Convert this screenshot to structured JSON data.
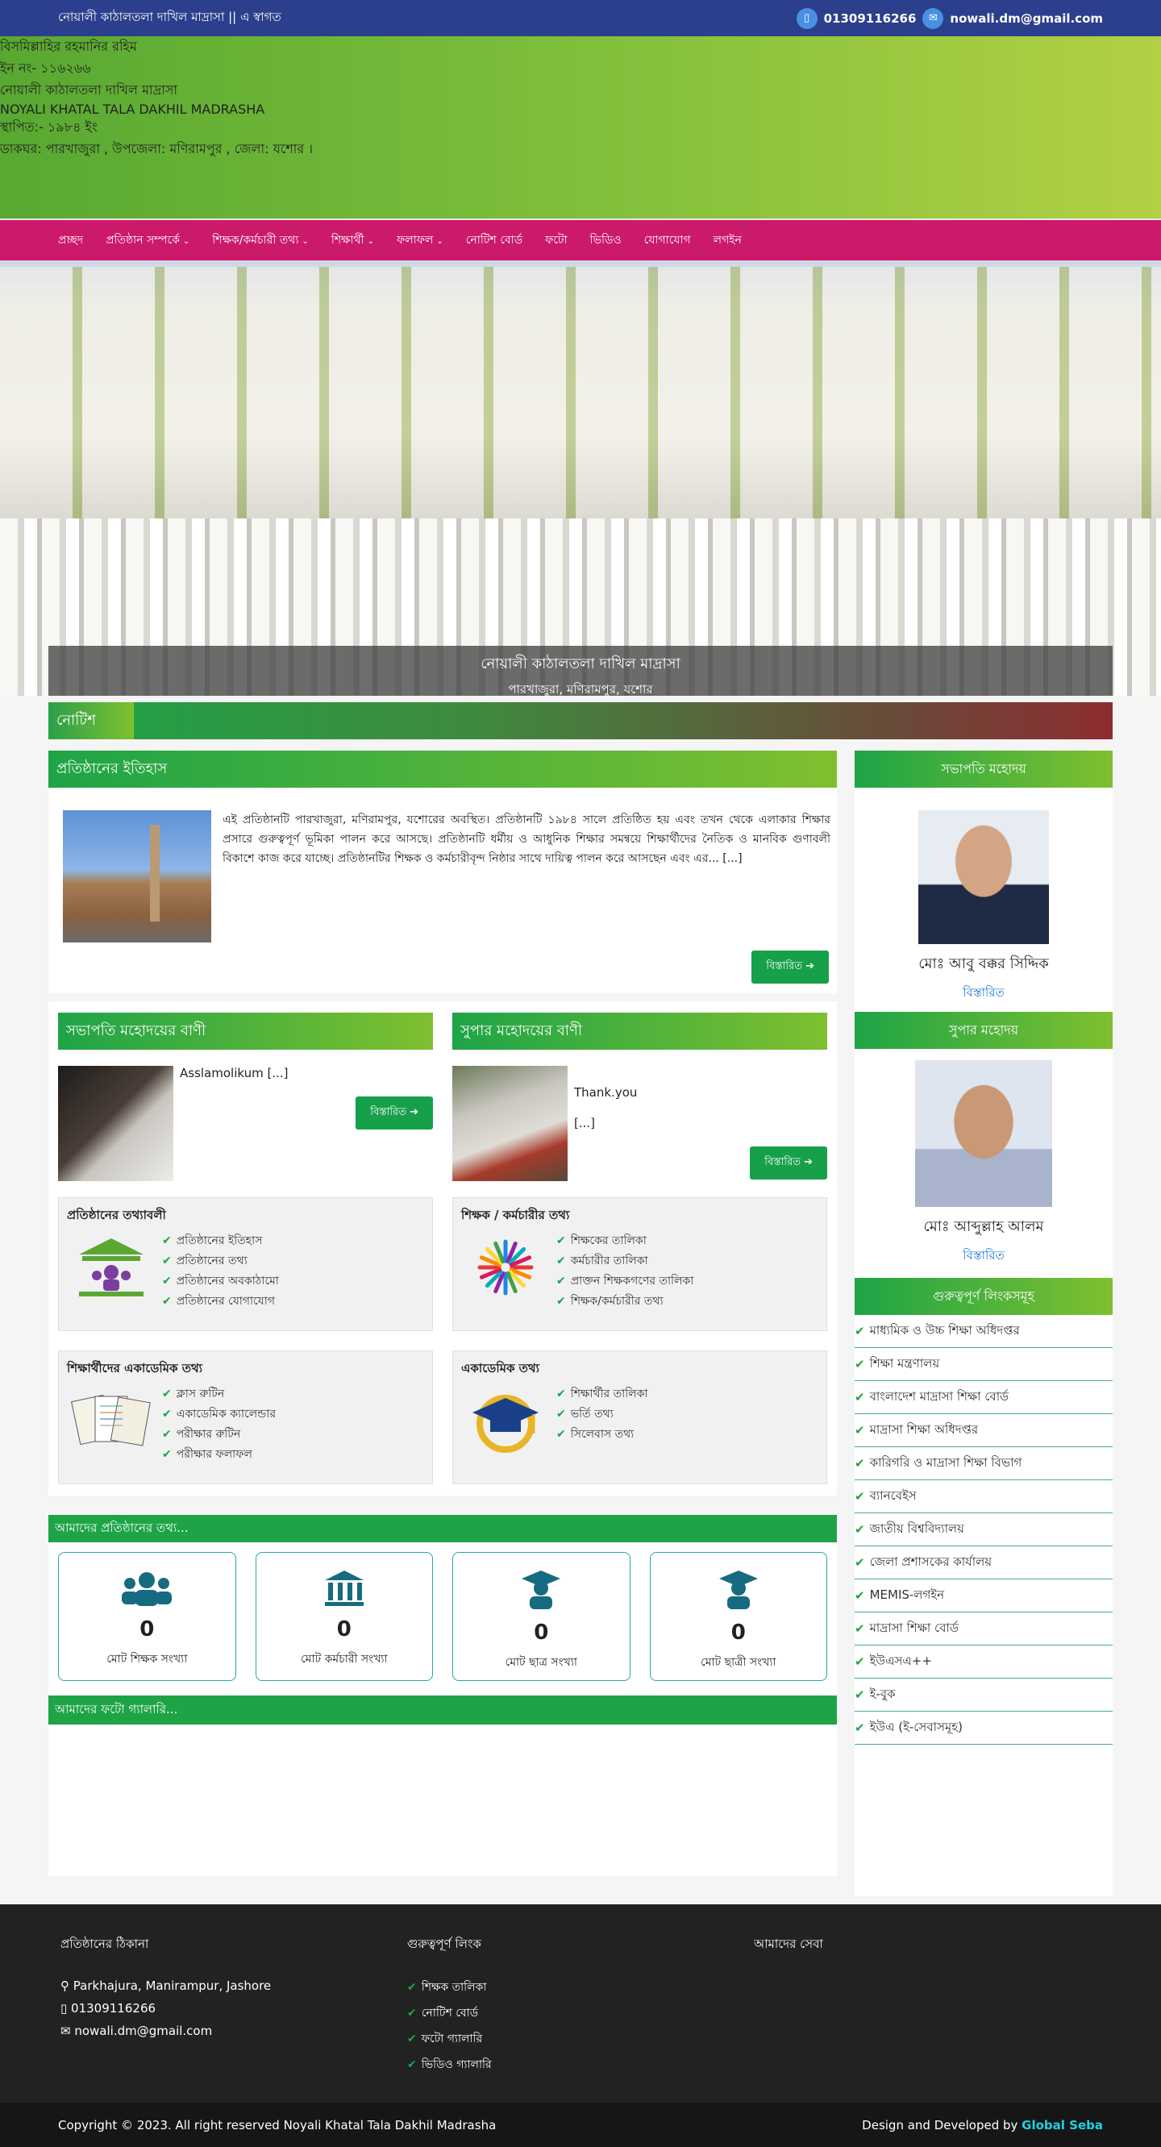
{
  "topbar": {
    "welcome": "নোয়ালী কাঠালতলা দাখিল মাদ্রাসা || এ স্বাগত",
    "phone": "01309116266",
    "email": "nowali.dm@gmail.com"
  },
  "header": {
    "bismillah": "বিসমিল্লাহির রহমানির রহিম",
    "ein": "ইন নং- ১১৬২৬৬",
    "name_bn": "নোয়ালী কাঠালতলা দাখিল মাদ্রাসা",
    "name_en": "NOYALI KHATAL TALA DAKHIL MADRASHA",
    "established": "স্থাপিত:- ১৯৮৪ ইং",
    "address": "ডাকঘর: পারখাজুরা , উপজেলা: মণিরামপুর , জেলা: যশোর ।"
  },
  "nav": {
    "items": [
      {
        "label": "প্রচ্ছদ",
        "caret": false
      },
      {
        "label": "প্রতিষ্ঠান সম্পর্কে",
        "caret": true
      },
      {
        "label": "শিক্ষক/কর্মচারী তথ্য",
        "caret": true
      },
      {
        "label": "শিক্ষার্থী",
        "caret": true
      },
      {
        "label": "ফলাফল",
        "caret": true
      },
      {
        "label": "নোটিশ বোর্ড",
        "caret": false
      },
      {
        "label": "ফটো",
        "caret": false
      },
      {
        "label": "ভিডিও",
        "caret": false
      },
      {
        "label": "যোগাযোগ",
        "caret": false
      },
      {
        "label": "লগইন",
        "caret": false
      }
    ]
  },
  "hero": {
    "title": "নোয়ালী কাঠালতলা দাখিল মাদ্রাসা",
    "subtitle": "পারখাজুরা, মণিরামপুর, যশোর"
  },
  "notice": {
    "label": "নোটিশ"
  },
  "about": {
    "title": "প্রতিষ্ঠানের ইতিহাস",
    "text": "এই প্রতিষ্ঠানটি পারখাজুরা, মণিরামপুর, যশোরের অবস্থিত। প্রতিষ্ঠানটি ১৯৮৪ সালে প্রতিষ্ঠিত হয় এবং তখন থেকে এলাকার শিক্ষার প্রসারে গুরুত্বপূর্ণ ভূমিকা পালন করে আসছে। প্রতিষ্ঠানটি ধর্মীয় ও আধুনিক শিক্ষার সমন্বয়ে শিক্ষার্থীদের নৈতিক ও মানবিক গুণাবলী বিকাশে কাজ করে যাচ্ছে। প্রতিষ্ঠানটির শিক্ষক ও কর্মচারীবৃন্দ নিষ্ঠার সাথে দায়িত্ব পালন করে আসছেন এবং এর... [...]",
    "more": "বিস্তারিত"
  },
  "messages": [
    {
      "title": "সভাপতি মহোদয়ের বাণী",
      "text": "Asslamolikum [...]",
      "more": "বিস্তারিত"
    },
    {
      "title": "সুপার মহোদয়ের বাণী",
      "text": "Thank.you",
      "text2": "[...]",
      "more": "বিস্তারিত"
    }
  ],
  "info_boxes": [
    {
      "title": "প্রতিষ্ঠানের তথ্যাবলী",
      "icon": "institution-icon",
      "items": [
        "প্রতিষ্ঠানের ইতিহাস",
        "প্রতিষ্ঠানের তথ্য",
        "প্রতিষ্ঠানের অবকাঠামো",
        "প্রতিষ্ঠানের যোগাযোগ"
      ]
    },
    {
      "title": "শিক্ষক / কর্মচারীর তথ্য",
      "icon": "learning-icon",
      "items": [
        "শিক্ষকের তালিকা",
        "কর্মচারীর তালিকা",
        "প্রাক্তন শিক্ষকগণের তালিকা",
        "শিক্ষক/কর্মচারীর তথ্য"
      ]
    },
    {
      "title": "শিক্ষার্থীদের একাডেমিক তথ্য",
      "icon": "documents-icon",
      "items": [
        "ক্লাস রুটিন",
        "একাডেমিক ক্যালেন্ডার",
        "পরীক্ষার রুটিন",
        "পরীক্ষার ফলাফল"
      ]
    },
    {
      "title": "একাডেমিক তথ্য",
      "icon": "graduation-cap-icon",
      "items": [
        "শিক্ষার্থীর তালিকা",
        "ভর্তি তথ্য",
        "সিলেবাস তথ্য"
      ]
    }
  ],
  "stats": {
    "title": "আমাদের প্রতিষ্ঠানের তথ্য...",
    "items": [
      {
        "icon": "users-icon",
        "value": "0",
        "label": "মোট শিক্ষক সংখ্যা"
      },
      {
        "icon": "institution-icon",
        "value": "0",
        "label": "মোট কর্মচারী সংখ্যা"
      },
      {
        "icon": "graduate-icon",
        "value": "0",
        "label": "মোট ছাত্র সংখ্যা"
      },
      {
        "icon": "graduate-icon",
        "value": "0",
        "label": "মোট ছাত্রী সংখ্যা"
      }
    ]
  },
  "gallery": {
    "title": "আমাদের ফটো গ্যালারি..."
  },
  "sidebar": {
    "president": {
      "head": "সভাপতি মহোদয়",
      "name": "মোঃ আবু বক্কর সিদ্দিক",
      "role": "বিস্তারিত"
    },
    "super": {
      "head": "সুপার মহোদয়",
      "name": "মোঃ আব্দুল্লাহ আলম",
      "role": "বিস্তারিত"
    },
    "links_head": "গুরুত্বপূর্ণ লিংকসমূহ",
    "links": [
      "মাধ্যমিক ও উচ্চ শিক্ষা অধিদপ্তর",
      "শিক্ষা মন্ত্রণালয়",
      "বাংলাদেশ মাদ্রাসা শিক্ষা বোর্ড",
      "মাদ্রাসা শিক্ষা অধিদপ্তর",
      "কারিগরি ও মাদ্রাসা শিক্ষা বিভাগ",
      "ব্যানবেইস",
      "জাতীয় বিশ্ববিদ্যালয়",
      "জেলা প্রশাসকের কার্যালয়",
      "MEMIS-লগইন",
      "মাদ্রাসা শিক্ষা বোর্ড",
      "ইউএসএ++",
      "ই-বুক",
      "ইউএ (ই-সেবাসমূহ)"
    ]
  },
  "footer": {
    "col1_title": "প্রতিষ্ঠানের ঠিকানা",
    "address": "Parkhajura, Manirampur, Jashore",
    "phone": "01309116266",
    "email": "nowali.dm@gmail.com",
    "col2_title": "গুরুত্বপূর্ণ লিংক",
    "links": [
      "শিক্ষক তালিকা",
      "নোটিশ বোর্ড",
      "ফটো গ্যালারি",
      "ভিডিও গ্যালারি"
    ],
    "col3_title": "আমাদের সেবা",
    "copyright": "Copyright © 2023. All right reserved Noyali Khatal Tala Dakhil Madrasha",
    "developed_by": "Design and Developed by",
    "developer": "Global Seba"
  }
}
